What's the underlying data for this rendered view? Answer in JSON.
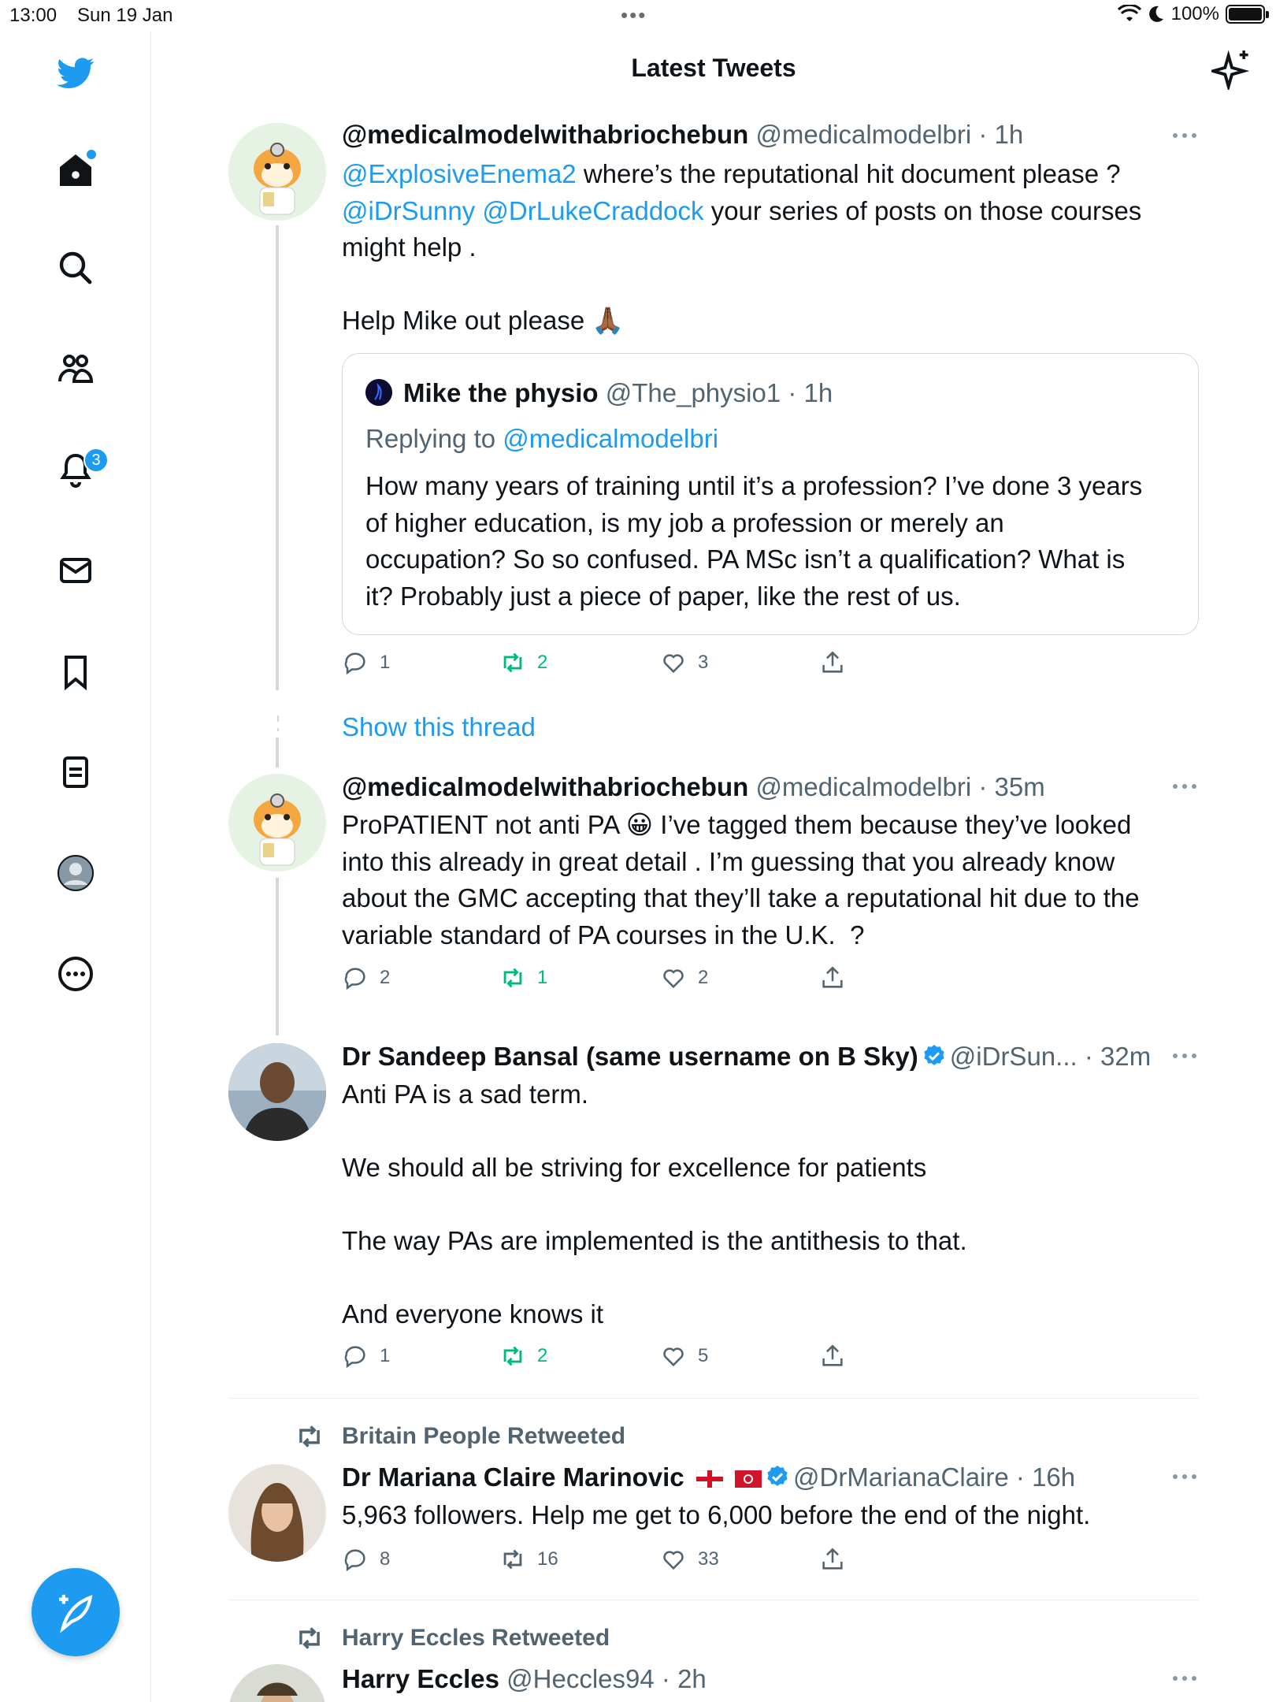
{
  "status_bar": {
    "time": "13:00",
    "date": "Sun 19 Jan",
    "battery": "100%"
  },
  "header": {
    "title": "Latest Tweets"
  },
  "sidebar": {
    "notifications_badge": "3"
  },
  "colors": {
    "accent": "#1d9bf0",
    "retweet_green": "#00ba7c",
    "muted": "#536471"
  },
  "tweets": [
    {
      "name": "@medicalmodelwithabriochebun",
      "handle": "@medicalmodelbri",
      "time": "· 1h",
      "mention1": "@ExplosiveEnema2",
      "text1": " where’s the reputational hit document please ?",
      "mention2": "@iDrSunny",
      "mention3": "@DrLukeCraddock",
      "text2": " your series of posts on those courses",
      "text3": "might help .",
      "text4": "Help Mike out please 🙏🏾",
      "quote": {
        "name": "Mike the physio",
        "handle": "@The_physio1",
        "time": "· 1h",
        "replying_prefix": "Replying to ",
        "replying_to": "@medicalmodelbri",
        "text": "How many years of training until it’s a profession? I’ve done 3 years\nof higher education, is my job a profession or merely an\noccupation? So so confused. PA MSc isn’t a qualification? What is\nit? Probably just a piece of paper, like the rest of us."
      },
      "replies": "1",
      "retweets": "2",
      "likes": "3",
      "show_thread": "Show this thread"
    },
    {
      "name": "@medicalmodelwithabriochebun",
      "handle": "@medicalmodelbri",
      "time": "· 35m",
      "text": "ProPATIENT not anti PA 😀 I’ve tagged them because they’ve looked\ninto this already in great detail . I’m guessing that you already know\nabout the GMC accepting that they’ll take a reputational hit due to the\nvariable standard of PA courses in the U.K.  ?",
      "replies": "2",
      "retweets": "1",
      "likes": "2"
    },
    {
      "name": "Dr Sandeep Bansal (same username on B Sky)",
      "handle": "@iDrSun...",
      "time": "· 32m",
      "text": "Anti PA is a sad term.\n\nWe should all be striving for excellence for patients\n\nThe way PAs are implemented is the antithesis to that.\n\nAnd everyone knows it",
      "replies": "1",
      "retweets": "2",
      "likes": "5"
    },
    {
      "retweeted_by": "Britain People Retweeted",
      "name": "Dr Mariana Claire Marinovic",
      "handle": "@DrMarianaClaire",
      "time": "· 16h",
      "text": "5,963 followers. Help me get to 6,000 before the end of the night.",
      "replies": "8",
      "retweets": "16",
      "likes": "33"
    },
    {
      "retweeted_by": "Harry Eccles Retweeted",
      "name": "Harry Eccles",
      "handle": "@Heccles94",
      "time": "· 2h"
    }
  ]
}
